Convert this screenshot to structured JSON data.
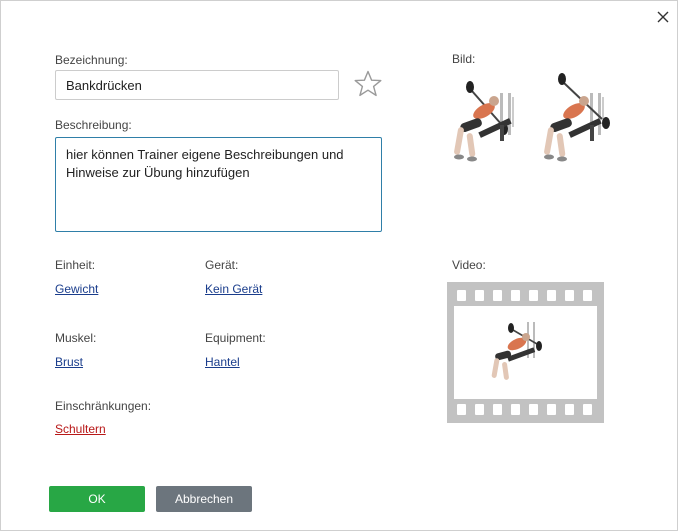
{
  "form": {
    "name_label": "Bezeichnung:",
    "name_value": "Bankdrücken",
    "description_label": "Beschreibung:",
    "description_value": "hier können Trainer eigene Beschreibungen und Hinweise zur Übung hinzufügen",
    "unit_label": "Einheit:",
    "unit_value": "Gewicht",
    "device_label": "Gerät:",
    "device_value": "Kein Gerät",
    "muscle_label": "Muskel:",
    "muscle_value": "Brust",
    "equipment_label": "Equipment:",
    "equipment_value": "Hantel",
    "restrictions_label": "Einschränkungen:",
    "restrictions_value": "Schultern",
    "image_label": "Bild:",
    "video_label": "Video:"
  },
  "buttons": {
    "ok_label": "OK",
    "cancel_label": "Abbrechen"
  },
  "icons": {
    "close": "close-icon",
    "favorite": "star-outline-icon"
  },
  "colors": {
    "ok_button": "#28a745",
    "cancel_button": "#6c757d",
    "link": "#1a3d8c",
    "restriction_link": "#b81818",
    "textarea_border": "#2f7fa8"
  }
}
